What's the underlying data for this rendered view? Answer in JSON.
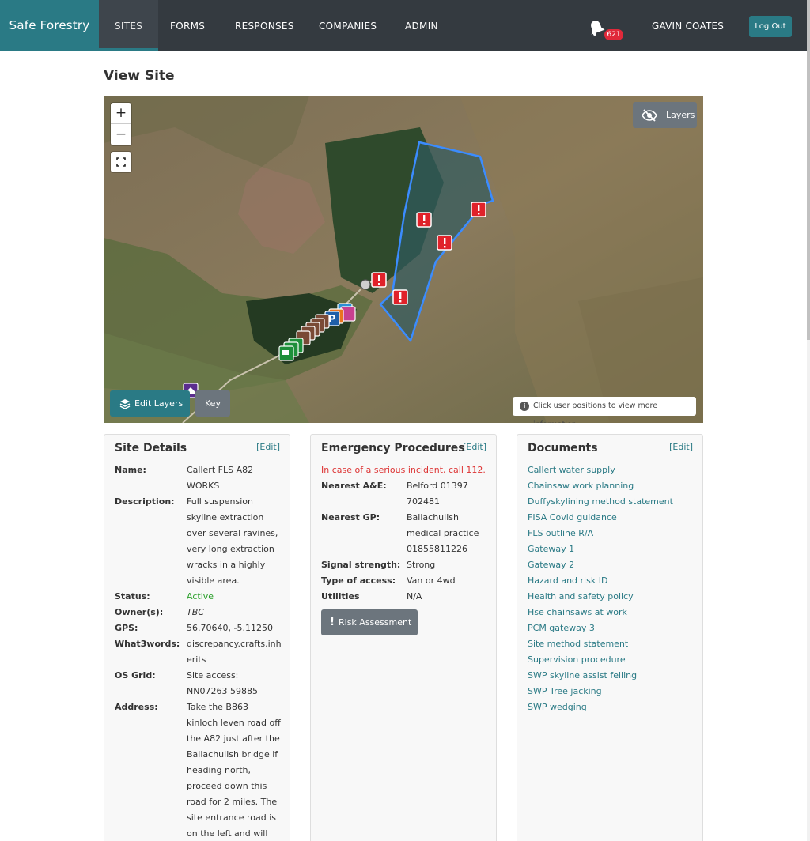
{
  "nav": {
    "brand": "Safe Forestry",
    "items": [
      {
        "label": "SITES"
      },
      {
        "label": "FORMS"
      },
      {
        "label": "RESPONSES"
      },
      {
        "label": "COMPANIES"
      },
      {
        "label": "ADMIN"
      }
    ],
    "notification_count": "621",
    "user_name": "GAVIN COATES",
    "logout_label": "Log Out"
  },
  "page": {
    "title": "View Site"
  },
  "map": {
    "zoom_in": "+",
    "zoom_out": "−",
    "layers_label": "Layers",
    "edit_layers_label": "Edit Layers",
    "key_label": "Key",
    "info_note": "Click user positions to view more information",
    "info_icon": "i"
  },
  "site_details": {
    "title": "Site Details",
    "edit_label": "[Edit]",
    "fields": [
      {
        "key": "Name:",
        "value": "Callert FLS A82 WORKS"
      },
      {
        "key": "Description:",
        "value": "Full suspension skyline extraction over several ravines, very long extraction wracks in a highly visible area."
      },
      {
        "key": "Status:",
        "value": "Active"
      },
      {
        "key": "Owner(s):",
        "value": "TBC"
      },
      {
        "key": "GPS:",
        "value": "56.70640, -5.11250"
      },
      {
        "key": "What3words:",
        "value": "discrepancy.crafts.inh erits"
      },
      {
        "key": "OS Grid:",
        "value": "Site access: NN07263 59885"
      },
      {
        "key": "Address:",
        "value": "Take the B863 kinloch leven road off the A82 just after the Ballachulish bridge if heading north, proceed down this road for 2 miles. The site entrance road is on the left and will"
      }
    ]
  },
  "emergency": {
    "title": "Emergency Procedures",
    "edit_label": "[Edit]",
    "warning": "In case of a serious incident, call 112.",
    "fields": [
      {
        "key": "Nearest A&E:",
        "value": "Belford 01397 702481"
      },
      {
        "key": "Nearest GP:",
        "value": "Ballachulish medical practice 01855811226"
      },
      {
        "key": "Signal strength:",
        "value": "Strong"
      },
      {
        "key": "Type of access:",
        "value": "Van or 4wd"
      },
      {
        "key": "Utilities contacts:",
        "value": "N/A"
      }
    ],
    "risk_button_icon": "!",
    "risk_button_label": "Risk Assessment"
  },
  "documents": {
    "title": "Documents",
    "edit_label": "[Edit]",
    "items": [
      "Callert water supply",
      "Chainsaw work planning",
      "Duffyskylining method statement",
      "FISA Covid guidance",
      "FLS outline R/A",
      "Gateway 1",
      "Gateway 2",
      "Hazard and risk ID",
      "Health and safety policy",
      "Hse chainsaws at work",
      "PCM gateway 3",
      "Site method statement",
      "Supervision procedure",
      "SWP skyline assist felling",
      "SWP Tree jacking",
      "SWP wedging"
    ]
  },
  "colors": {
    "brand": "#2a7a85",
    "navbar": "#343a40",
    "badge": "#e0293a",
    "secondary_button": "#6c757d",
    "status_active": "#2ca02c",
    "warning": "#dd3333",
    "site_boundary": "#3b8cff",
    "hazard_marker": "#e0222a"
  },
  "icons": [
    "bell-icon",
    "eye-slash-icon",
    "layers-stack-icon",
    "fullscreen-icon",
    "info-icon",
    "hazard-icon",
    "parking-icon",
    "exclamation-icon"
  ]
}
